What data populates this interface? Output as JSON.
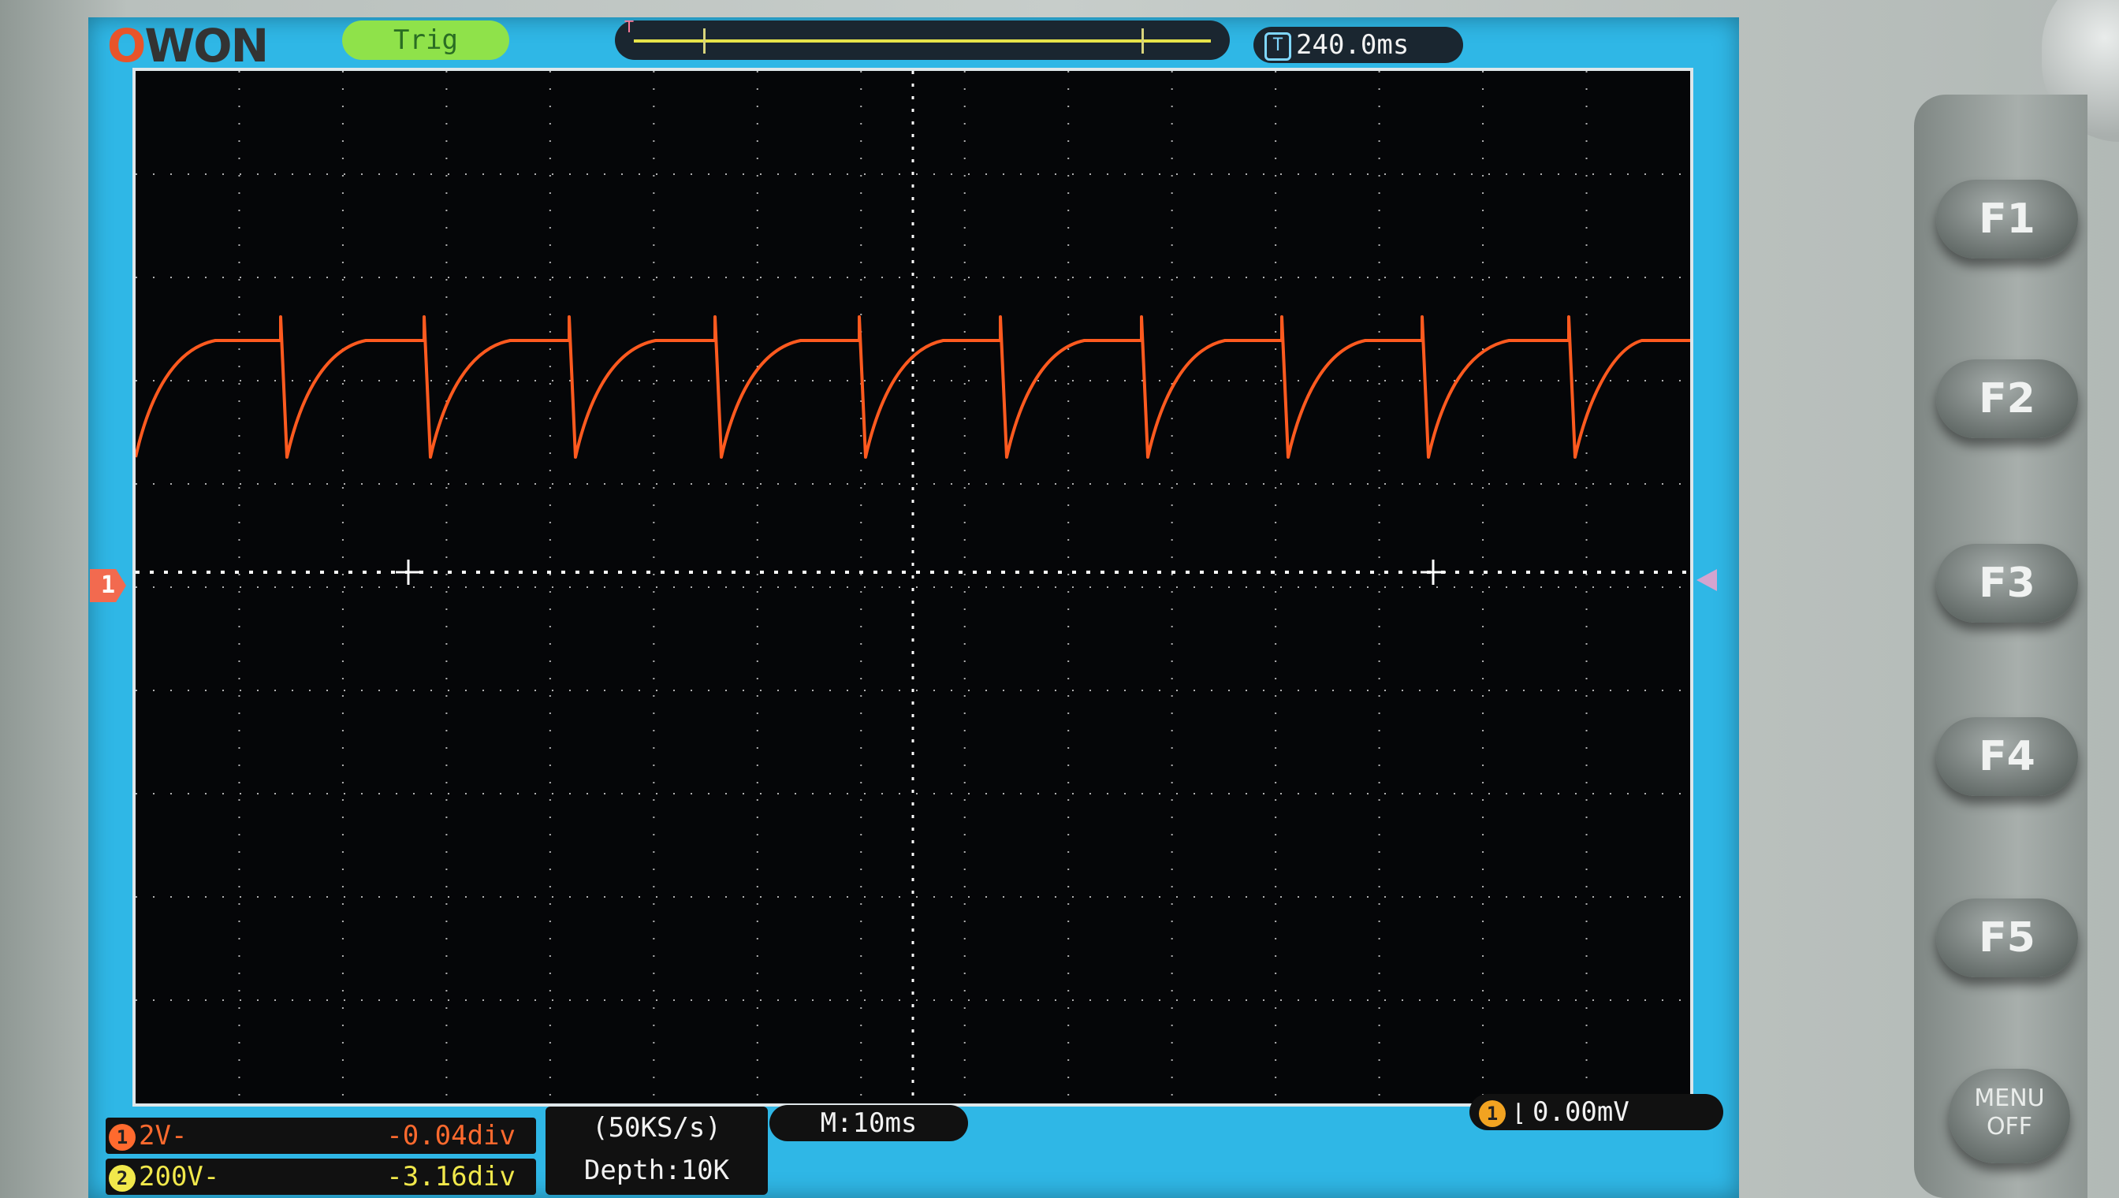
{
  "brand": {
    "logo_text": "OWON",
    "logo_o": "O",
    "logo_rest": "WON"
  },
  "top": {
    "trigger_state": "Trig",
    "trigger_marker": "T",
    "time_icon": "T",
    "time_offset": "240.0ms"
  },
  "markers": {
    "ch1": "1"
  },
  "channels": [
    {
      "num": "1",
      "scale": "2V-",
      "offset": "-0.04div",
      "color": "#ff6a2e"
    },
    {
      "num": "2",
      "scale": "200V-",
      "offset": "-3.16div",
      "color": "#f1e84b"
    }
  ],
  "acquisition": {
    "rate": "(50KS/s)",
    "depth": "Depth:10K"
  },
  "timebase": {
    "label": "M:10ms"
  },
  "trigger": {
    "num": "1",
    "edge_symbol": "⌊",
    "level": "0.00mV"
  },
  "buttons": {
    "f1": "F1",
    "f2": "F2",
    "f3": "F3",
    "f4": "F4",
    "f5": "F5",
    "menu_line1": "MENU",
    "menu_line2": "OFF"
  },
  "colors": {
    "trace": "#ff5a1f",
    "screen_bg": "#2fb7e6",
    "grid_bg": "#050608"
  }
}
